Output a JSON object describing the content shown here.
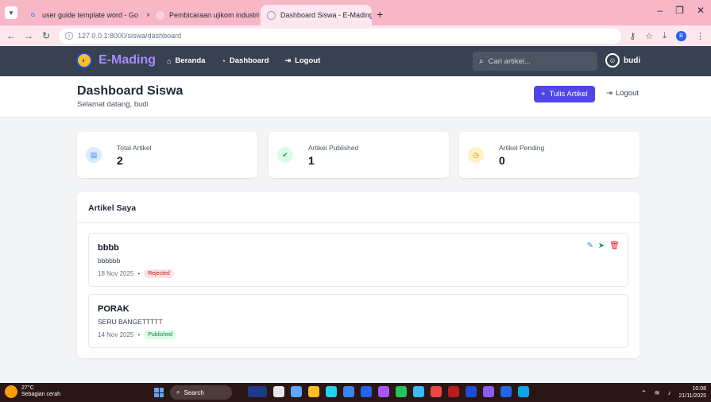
{
  "browser": {
    "tabs": [
      {
        "label": "user guide template word - Go",
        "icon": "google-icon",
        "active": false
      },
      {
        "label": "Pembicaraan ujikom industri",
        "icon": "chat-icon",
        "active": false
      },
      {
        "label": "Dashboard Siswa - E-Mading",
        "icon": "globe-icon",
        "active": true
      }
    ],
    "url": "127.0.0.1:8000/siswa/dashboard",
    "profile_initial": "B"
  },
  "navbar": {
    "brand": "E-Mading",
    "links": [
      {
        "label": "Beranda",
        "icon": "home-icon"
      },
      {
        "label": "Dashboard",
        "icon": "dashboard-icon"
      },
      {
        "label": "Logout",
        "icon": "logout-icon"
      }
    ],
    "search_placeholder": "Cari artikel...",
    "username": "budi"
  },
  "header": {
    "title": "Dashboard Siswa",
    "subtitle": "Selamat datang, budi",
    "write_button": "Tulis Artikel",
    "logout_button": "Logout"
  },
  "stats": [
    {
      "label": "Total Artikel",
      "value": "2",
      "icon": "newspaper-icon",
      "color": "#3b82f6",
      "bg": "#dbeafe"
    },
    {
      "label": "Artikel Published",
      "value": "1",
      "icon": "check-icon",
      "color": "#16a34a",
      "bg": "#dcfce7"
    },
    {
      "label": "Artikel Pending",
      "value": "0",
      "icon": "clock-icon",
      "color": "#d97706",
      "bg": "#fef3c7"
    }
  ],
  "articles_section": {
    "title": "Artikel Saya",
    "items": [
      {
        "title": "bbbb",
        "body": "bbbbbb",
        "date": "18 Nov 2025",
        "status": "Rejected"
      },
      {
        "title": "PORAK",
        "body": "SERU BANGETTTTT",
        "date": "14 Nov 2025",
        "status": "Published"
      }
    ]
  },
  "taskbar": {
    "temperature": "27°C",
    "weather": "Sebagian cerah",
    "search": "Search",
    "time": "10:08",
    "date": "21/11/2025"
  }
}
